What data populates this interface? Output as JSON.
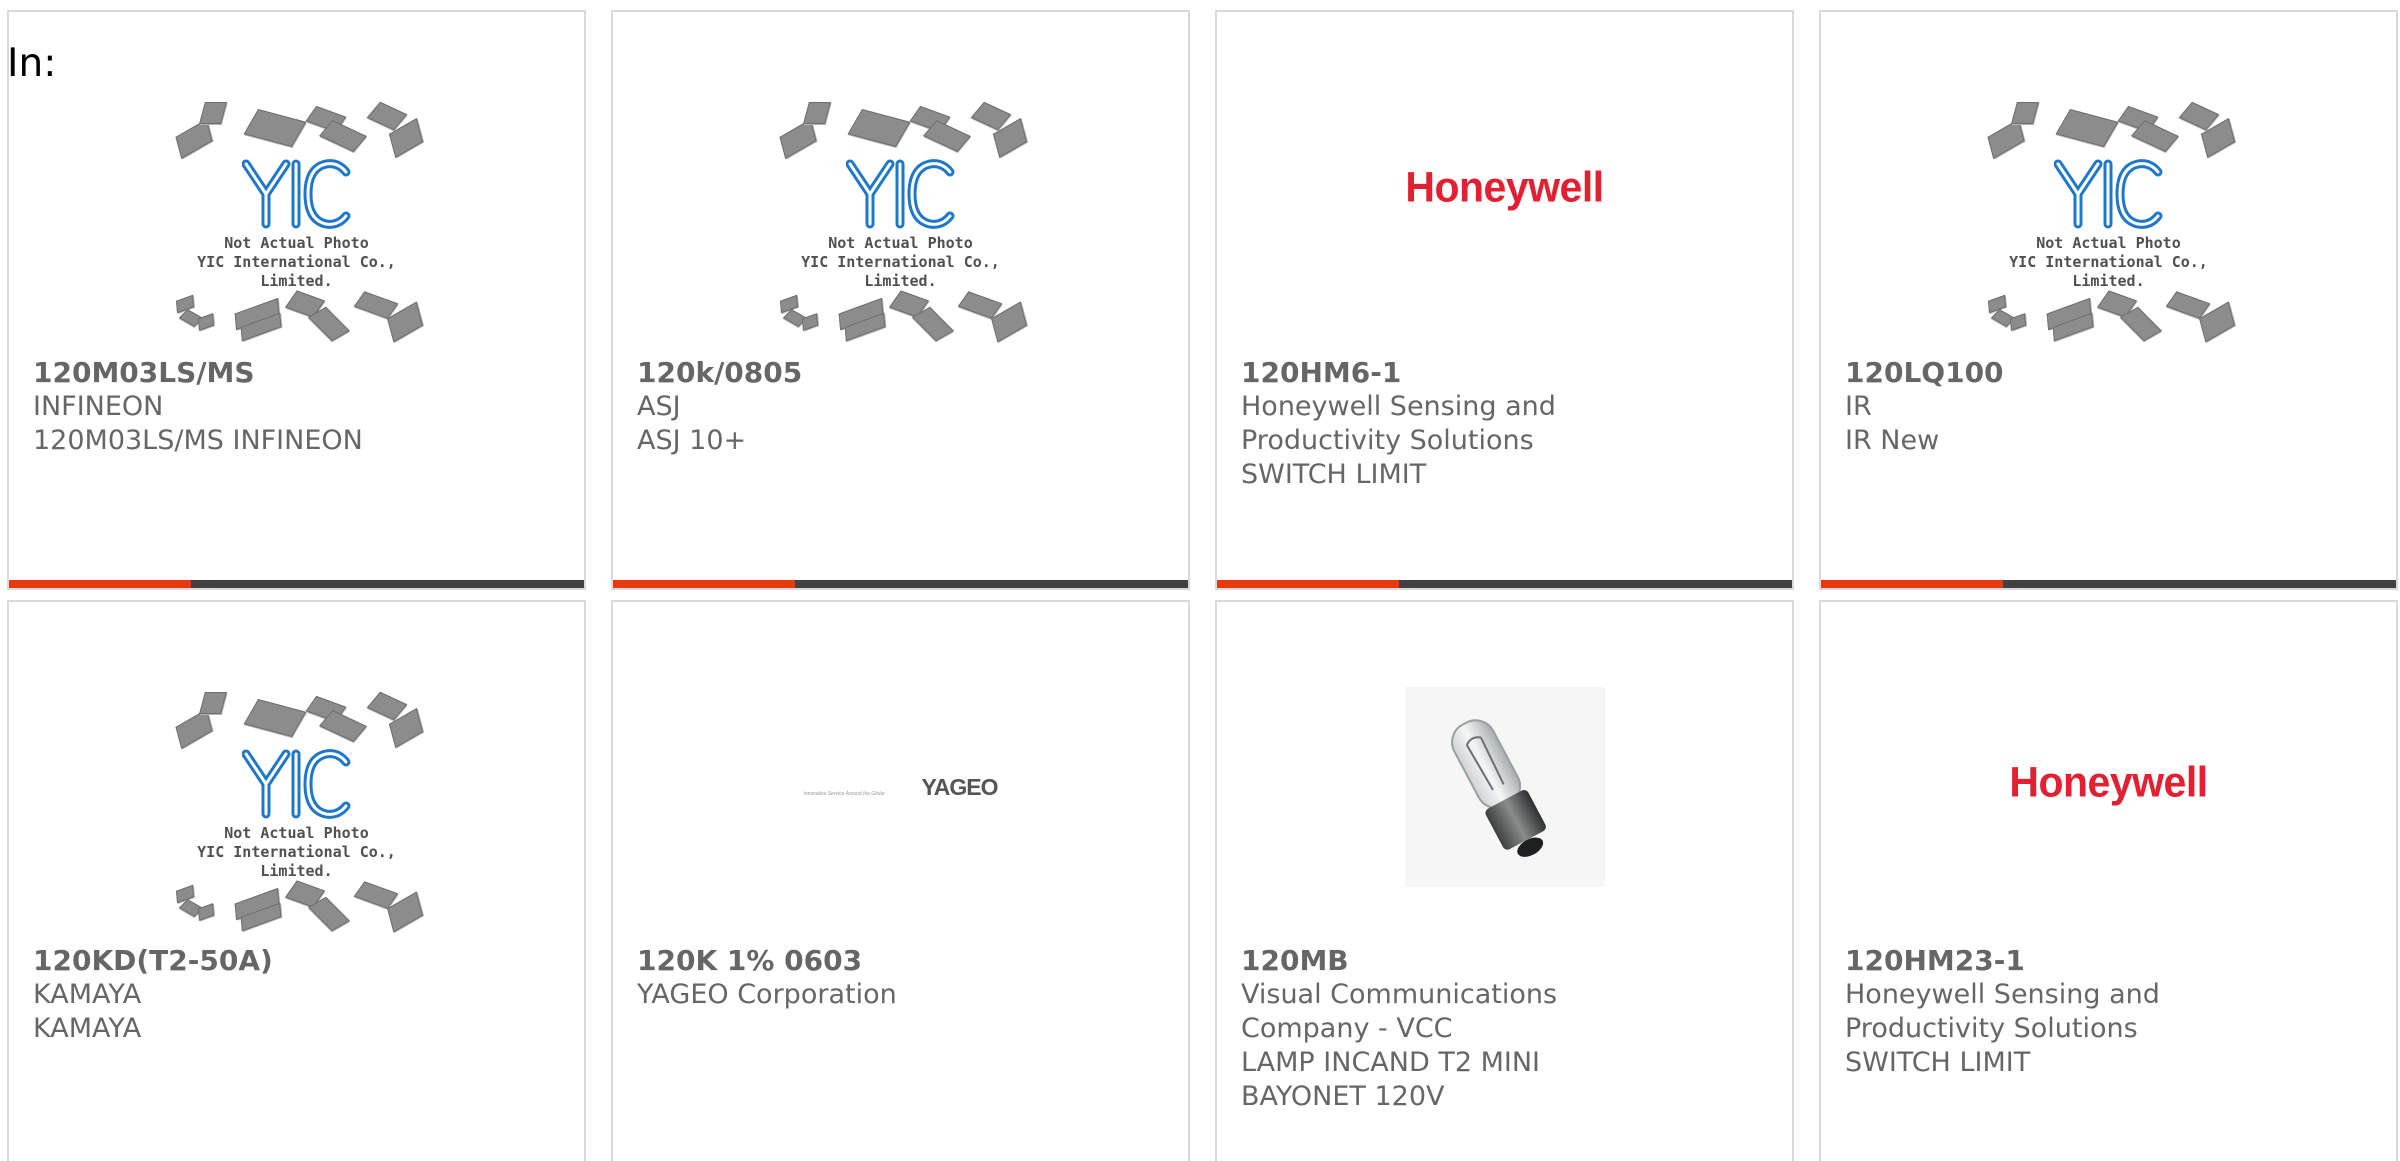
{
  "header": {
    "label": "In:"
  },
  "products": [
    {
      "part_number": "120M03LS/MS",
      "manufacturer": "INFINEON",
      "description": "120M03LS/MS INFINEON",
      "image": "yic-placeholder"
    },
    {
      "part_number": "120k/0805",
      "manufacturer": "ASJ",
      "description": "ASJ 10+",
      "image": "yic-placeholder"
    },
    {
      "part_number": "120HM6-1",
      "manufacturer": "Honeywell Sensing and Productivity Solutions",
      "description": "SWITCH LIMIT",
      "image": "honeywell-logo"
    },
    {
      "part_number": "120LQ100",
      "manufacturer": "IR",
      "description": "IR New",
      "image": "yic-placeholder"
    },
    {
      "part_number": "120KD(T2-50A)",
      "manufacturer": "KAMAYA",
      "description": "KAMAYA",
      "image": "yic-placeholder"
    },
    {
      "part_number": "120K 1% 0603",
      "manufacturer": "YAGEO Corporation",
      "description": "",
      "image": "yageo-logo"
    },
    {
      "part_number": "120MB",
      "manufacturer": "Visual Communications Company - VCC",
      "description": "LAMP INCAND T2 MINI BAYONET 120V",
      "image": "lamp-photo"
    },
    {
      "part_number": "120HM23-1",
      "manufacturer": "Honeywell Sensing and Productivity Solutions",
      "description": "SWITCH LIMIT",
      "image": "honeywell-logo"
    }
  ],
  "placeholder": {
    "line1": "Not Actual Photo",
    "line2": "YIC International Co., Limited."
  },
  "logos": {
    "honeywell": "Honeywell",
    "yageo": "YAGEO",
    "yageo_tagline": "Innovative Service Around the Globe"
  },
  "colors": {
    "accent": "#e8380d",
    "bar": "#3f4142",
    "text": "#666666",
    "honeywell_red": "#e22032",
    "yic_blue": "#1f77c9"
  }
}
